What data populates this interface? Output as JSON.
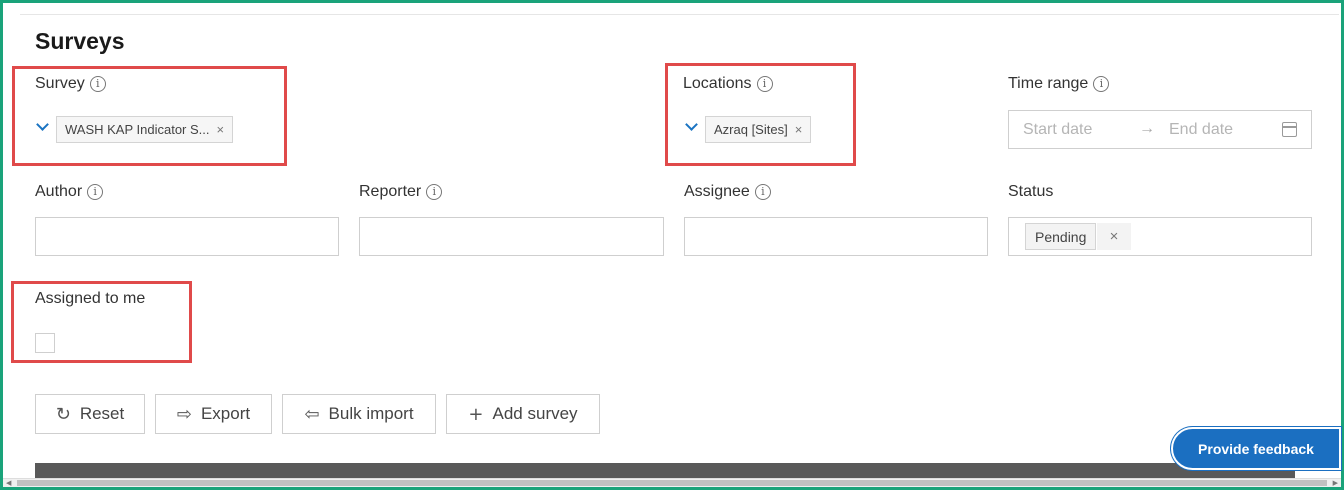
{
  "page": {
    "title": "Surveys"
  },
  "filters": {
    "survey": {
      "label": "Survey",
      "info": "i",
      "selected_tag": "WASH KAP Indicator S...",
      "remove": "×"
    },
    "locations": {
      "label": "Locations",
      "info": "i",
      "selected_tag": "Azraq [Sites]",
      "remove": "×"
    },
    "time_range": {
      "label": "Time range",
      "info": "i",
      "start_placeholder": "Start date",
      "arrow": "→",
      "end_placeholder": "End date"
    },
    "author": {
      "label": "Author",
      "info": "i",
      "value": ""
    },
    "reporter": {
      "label": "Reporter",
      "info": "i",
      "value": ""
    },
    "assignee": {
      "label": "Assignee",
      "info": "i",
      "value": ""
    },
    "status": {
      "label": "Status",
      "selected_tag": "Pending",
      "remove": "×"
    },
    "assigned_to_me": {
      "label": "Assigned to me",
      "checked": false
    }
  },
  "actions": {
    "reset": {
      "label": "Reset",
      "icon": "refresh-icon"
    },
    "export": {
      "label": "Export",
      "icon": "export-icon"
    },
    "bulk_import": {
      "label": "Bulk import",
      "icon": "import-icon"
    },
    "add_survey": {
      "label": "Add survey",
      "icon": "plus-icon"
    }
  },
  "feedback": {
    "label": "Provide feedback"
  },
  "colors": {
    "accent": "#1b74c2",
    "feedback_bg": "#1b6fc1",
    "highlight": "#e04a4a",
    "frame": "#1aa37a"
  }
}
